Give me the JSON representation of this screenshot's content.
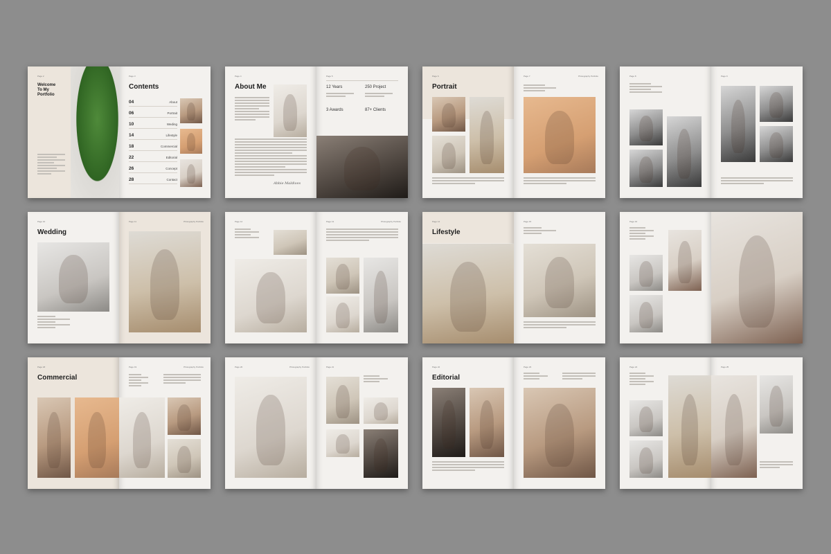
{
  "spread_welcome": {
    "welcome_title": "Welcome\nTo My\nPortfolio",
    "page_left": "Page 2",
    "page_right": "Page 3",
    "contents_title": "Contents",
    "toc": [
      {
        "num": "04",
        "label": "About"
      },
      {
        "num": "06",
        "label": "Portrait"
      },
      {
        "num": "10",
        "label": "Weding"
      },
      {
        "num": "14",
        "label": "Lifestyle"
      },
      {
        "num": "18",
        "label": "Commercial"
      },
      {
        "num": "22",
        "label": "Editorial"
      },
      {
        "num": "26",
        "label": "Concept"
      },
      {
        "num": "28",
        "label": "Contact"
      }
    ]
  },
  "spread_about": {
    "page_left": "Page 4",
    "page_right": "Page 5",
    "title": "About Me",
    "signature": "Abbie Maldives",
    "stats": [
      "12 Years",
      "250 Project",
      "3 Awards",
      "87+ Clients"
    ]
  },
  "spread_portrait": {
    "page_left": "Page 6",
    "page_right": "Page 7",
    "title": "Portrait",
    "header": "Photography Portfolio"
  },
  "spread_bw": {
    "page_left": "Page 8",
    "page_right": "Page 9"
  },
  "spread_wedding": {
    "page_left": "Page 10",
    "page_right": "Page 11",
    "title": "Wedding",
    "header": "Photography Portfolio"
  },
  "spread_wedding2": {
    "page_left": "Page 12",
    "page_right": "Page 13",
    "header": "Photography Portfolio"
  },
  "spread_lifestyle": {
    "page_left": "Page 14",
    "page_right": "Page 15",
    "title": "Lifestyle"
  },
  "spread_lifestyle2": {
    "page_left": "Page 16",
    "page_right": "Page 17"
  },
  "spread_commercial": {
    "page_left": "Page 18",
    "page_right": "Page 19",
    "title": "Commercial",
    "header": "Photography Portfolio"
  },
  "spread_commercial2": {
    "page_left": "Page 20",
    "page_right": "Page 21",
    "header": "Photography Portfolio"
  },
  "spread_editorial": {
    "page_left": "Page 22",
    "page_right": "Page 23",
    "title": "Editorial"
  },
  "spread_editorial2": {
    "page_left": "Page 24",
    "page_right": "Page 25"
  },
  "colors": {
    "background": "#8d8d8d",
    "paper": "#f3f1ee",
    "paper_beige": "#ece5dc",
    "text": "#1d1d1d"
  }
}
